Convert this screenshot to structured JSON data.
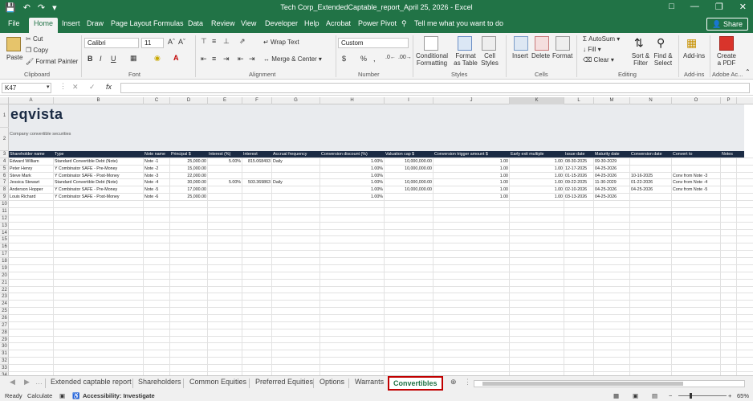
{
  "window": {
    "title": "Tech Corp_ExtendedCaptable_report_April 25, 2026  -  Excel"
  },
  "ribbon_tabs": [
    "File",
    "Home",
    "Insert",
    "Draw",
    "Page Layout",
    "Formulas",
    "Data",
    "Review",
    "View",
    "Developer",
    "Help",
    "Acrobat",
    "Power Pivot"
  ],
  "active_tab": "Home",
  "tell_me": "Tell me what you want to do",
  "share_label": "Share",
  "ribbon": {
    "paste": "Paste",
    "cut": "Cut",
    "copy": "Copy",
    "format_painter": "Format Painter",
    "clipboard": "Clipboard",
    "font_name": "Calibri",
    "font_size": "11",
    "bold": "B",
    "italic": "I",
    "underline": "U",
    "font": "Font",
    "wrap_text": "Wrap Text",
    "merge_center": "Merge & Center",
    "alignment": "Alignment",
    "number_format": "Custom",
    "currency": "$",
    "percent": "%",
    "number": "Number",
    "conditional_formatting": "Conditional Formatting",
    "format_as_table": "Format as Table",
    "cell_styles": "Cell Styles",
    "styles": "Styles",
    "insert": "Insert",
    "delete": "Delete",
    "format": "Format",
    "cells": "Cells",
    "autosum": "AutoSum",
    "fill": "Fill",
    "clear": "Clear",
    "sort_filter": "Sort & Filter",
    "find_select": "Find & Select",
    "editing": "Editing",
    "addins": "Add-ins",
    "addins_group": "Add-ins",
    "create_pdf": "Create a PDF",
    "adobe_group": "Adobe Ac..."
  },
  "formula_bar": {
    "name_box": "K47",
    "fx": "fx",
    "formula": ""
  },
  "columns": [
    "A",
    "B",
    "C",
    "D",
    "E",
    "F",
    "G",
    "H",
    "I",
    "J",
    "K",
    "L",
    "M",
    "N",
    "O",
    "P"
  ],
  "rows": [
    "1",
    "2",
    "3",
    "4",
    "5",
    "6",
    "7",
    "8",
    "9",
    "10",
    "11",
    "12",
    "13",
    "14",
    "15",
    "16",
    "17",
    "18",
    "19",
    "20",
    "21",
    "22",
    "23",
    "24",
    "25",
    "26",
    "27",
    "28",
    "29",
    "30",
    "31",
    "32",
    "33",
    "34",
    "35",
    "36",
    "37",
    "38"
  ],
  "sheet": {
    "logo": "eqvista",
    "subtitle": "Company convertible securities",
    "headers": [
      "Shareholder name",
      "Type",
      "Note name",
      "Principal $",
      "Interest (%)",
      "Interest",
      "Accrual frequency",
      "Conversion discount (%)",
      "Valuation cap $",
      "Conversion trigger amount $",
      "Early exit multiple",
      "Issue date",
      "Maturity date",
      "Conversion date",
      "Convert to",
      "Notes"
    ],
    "rows": [
      [
        "Edward William",
        "Standard Convertible Debt (Note)",
        "Note -1",
        "25,000.00",
        "5.00%",
        "815.068493",
        "Daily",
        "1.00%",
        "10,000,000.00",
        "1.00",
        "1.00",
        "08-30-2025",
        "09-30-2029",
        "",
        "",
        ""
      ],
      [
        "Peter Henry",
        "Y Combinator SAFE - Pre-Money",
        "Note -2",
        "15,000.00",
        "",
        "",
        "",
        "1.00%",
        "10,000,000.00",
        "1.00",
        "1.00",
        "12-17-2025",
        "04-25-2026",
        "",
        "",
        ""
      ],
      [
        "Steve Mark",
        "Y Combinator SAFE - Post-Money",
        "Note -3",
        "22,000.00",
        "",
        "",
        "",
        "1.00%",
        "",
        "1.00",
        "1.00",
        "01-15-2026",
        "04-25-2026",
        "10-16-2025",
        "Conv from Note -3",
        ""
      ],
      [
        "Jessica Stewart",
        "Standard Convertible Debt (Note)",
        "Note -4",
        "30,000.00",
        "5.00%",
        "503.369863",
        "Daily",
        "1.00%",
        "10,000,000.00",
        "1.00",
        "1.00",
        "09-22-2025",
        "11-30-2029",
        "01-22-2026",
        "Conv from Note -4",
        ""
      ],
      [
        "Anderson Hopper",
        "Y Combinator SAFE - Pre-Money",
        "Note -5",
        "17,000.00",
        "",
        "",
        "",
        "1.00%",
        "10,000,000.00",
        "1.00",
        "1.00",
        "02-10-2026",
        "04-25-2026",
        "04-25-2026",
        "Conv from Note -5",
        ""
      ],
      [
        "Louis Richard",
        "Y Combinator SAFE - Post-Money",
        "Note -6",
        "25,000.00",
        "",
        "",
        "",
        "1.00%",
        "",
        "1.00",
        "1.00",
        "03-13-2026",
        "04-25-2026",
        "",
        "",
        ""
      ]
    ]
  },
  "sheet_tabs": [
    "Extended captable report",
    "Shareholders",
    "Common Equities",
    "Preferred Equities",
    "Options",
    "Warrants",
    "Convertibles"
  ],
  "active_sheet": "Convertibles",
  "status": {
    "ready": "Ready",
    "calculate": "Calculate",
    "accessibility": "Accessibility: Investigate",
    "zoom": "65%"
  }
}
